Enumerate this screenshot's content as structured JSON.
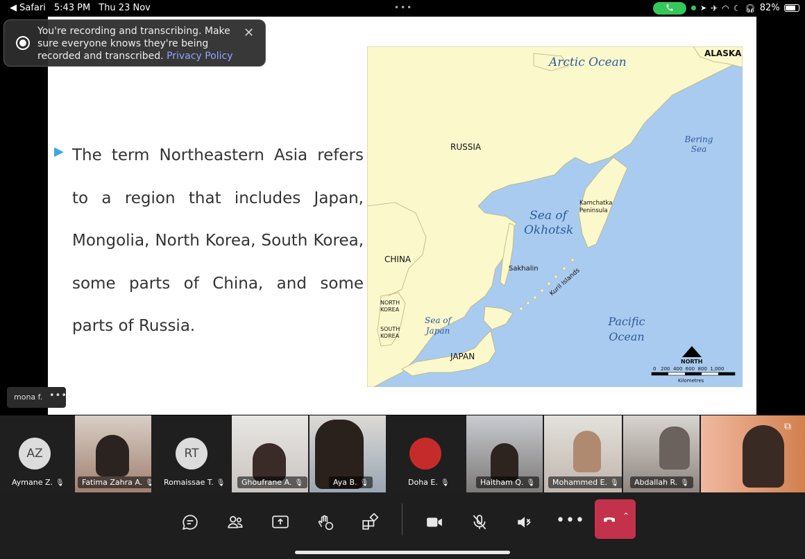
{
  "status_bar": {
    "back_app": "◀ Safari",
    "time": "5:43 PM",
    "date": "Thu 23 Nov",
    "call_icon": "phone-icon",
    "battery": "82%",
    "battery_level": 0.82
  },
  "banner": {
    "text": "You're recording and transcribing. Make sure everyone knows they're being recorded and transcribed.",
    "link": "Privacy Policy"
  },
  "slide": {
    "paragraph": "The term Northeastern Asia refers to a region that includes Japan, Mongolia, North Korea, South Korea, some parts of China, and some parts of Russia.",
    "map": {
      "labels": {
        "alaska": "ALASKA",
        "arctic": "Arctic Ocean",
        "russia": "RUSSIA",
        "bering": "Bering Sea",
        "okhotsk": "Sea of Okhotsk",
        "kamchatka": "Kamchatka Peninsula",
        "china": "CHINA",
        "sakhalin": "Sakhalin",
        "kuril": "Kuril Islands",
        "north_korea": "NORTH KOREA",
        "south_korea": "SOUTH KOREA",
        "sea_japan": "Sea of Japan",
        "pacific": "Pacific Ocean",
        "japan": "JAPAN",
        "north": "NORTH",
        "scale": "0   200  400  600  800  1,000",
        "units": "Kilometres"
      }
    }
  },
  "pinned": {
    "name": "mona f.",
    "more": "•••"
  },
  "participants": [
    {
      "name": "Aymane Z.",
      "initials": "AZ"
    },
    {
      "name": "Fatima Zahra A."
    },
    {
      "name": "Romaissae T.",
      "initials": "RT"
    },
    {
      "name": "Ghoufrane A."
    },
    {
      "name": "Aya B."
    },
    {
      "name": "Doha E."
    },
    {
      "name": "Haitham Q."
    },
    {
      "name": "Mohammed E."
    },
    {
      "name": "Abdallah R."
    },
    {
      "name": ""
    }
  ],
  "toolbar": {
    "chat": "chat-icon",
    "people": "people-icon",
    "share": "share-icon",
    "react": "react-icon",
    "apps": "apps-icon",
    "camera": "camera-icon",
    "mic": "mic-off-icon",
    "speaker": "speaker-icon",
    "more": "•••",
    "hangup": "hangup-icon"
  }
}
